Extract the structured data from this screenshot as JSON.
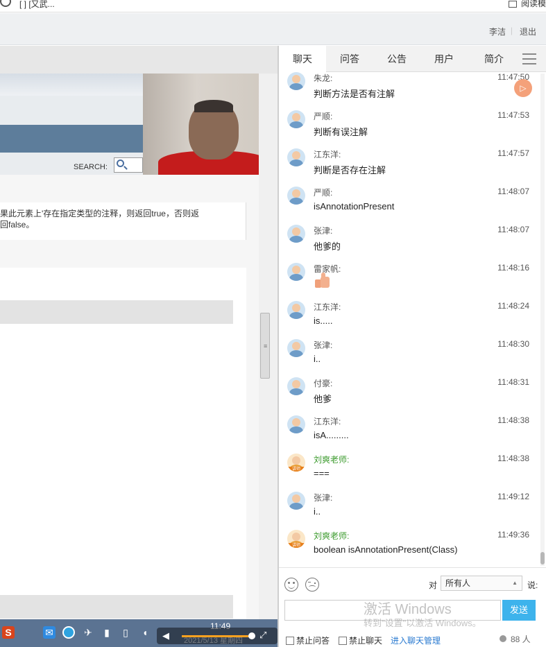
{
  "browser": {
    "tab_text": "[  ] [又武...",
    "reader_label": "阅读模"
  },
  "userbar": {
    "user_name": "李洁",
    "logout_label": "退出"
  },
  "document": {
    "search_label": "SEARCH:",
    "text_line1": "果此元素上'存在指定类型的注释，则返回true，否则返",
    "text_line2": "回false。"
  },
  "taskbar": {
    "time": "11:49",
    "date": "2021/5/13 星期四"
  },
  "chat": {
    "tabs": [
      "聊天",
      "问答",
      "公告",
      "用户",
      "简介"
    ],
    "messages": [
      {
        "sender": "朱龙:",
        "time": "11:47:50",
        "text": "判断方法是否有注解",
        "role": "student"
      },
      {
        "sender": "严顺:",
        "time": "11:47:53",
        "text": "判断有误注解",
        "role": "student"
      },
      {
        "sender": "江东洋:",
        "time": "11:47:57",
        "text": "判断是否存在注解",
        "role": "student"
      },
      {
        "sender": "严顺:",
        "time": "11:48:07",
        "text": "isAnnotationPresent",
        "role": "student"
      },
      {
        "sender": "张津:",
        "time": "11:48:07",
        "text": "他爹的",
        "role": "student"
      },
      {
        "sender": "雷家帆:",
        "time": "11:48:16",
        "text": "",
        "role": "student",
        "emoji": "thumbs-up"
      },
      {
        "sender": "江东洋:",
        "time": "11:48:24",
        "text": "is.....",
        "role": "student"
      },
      {
        "sender": "张津:",
        "time": "11:48:30",
        "text": "i..",
        "role": "student"
      },
      {
        "sender": "付豪:",
        "time": "11:48:31",
        "text": "他爹",
        "role": "student"
      },
      {
        "sender": "江东洋:",
        "time": "11:48:38",
        "text": "isA.........",
        "role": "student"
      },
      {
        "sender": "刘爽老师:",
        "time": "11:48:38",
        "text": "===",
        "role": "teacher"
      },
      {
        "sender": "张津:",
        "time": "11:49:12",
        "text": "i..",
        "role": "student"
      },
      {
        "sender": "刘爽老师:",
        "time": "11:49:36",
        "text": "boolean isAnnotationPresent(Class)",
        "role": "teacher"
      }
    ],
    "teacher_badge": "讲师",
    "to_label": "对",
    "to_value": "所有人",
    "say_label": "说:",
    "send_label": "发送",
    "watermark_title": "激活 Windows",
    "watermark_sub": "转到\"设置\"以激活 Windows。",
    "option_no_qa": "禁止问答",
    "option_no_chat": "禁止聊天",
    "manage_link": "进入聊天管理",
    "user_count": "88 人"
  },
  "colors": {
    "accent": "#3db3ec",
    "teacher_name": "#3a9a2b",
    "taskbar": "#5b7392"
  }
}
